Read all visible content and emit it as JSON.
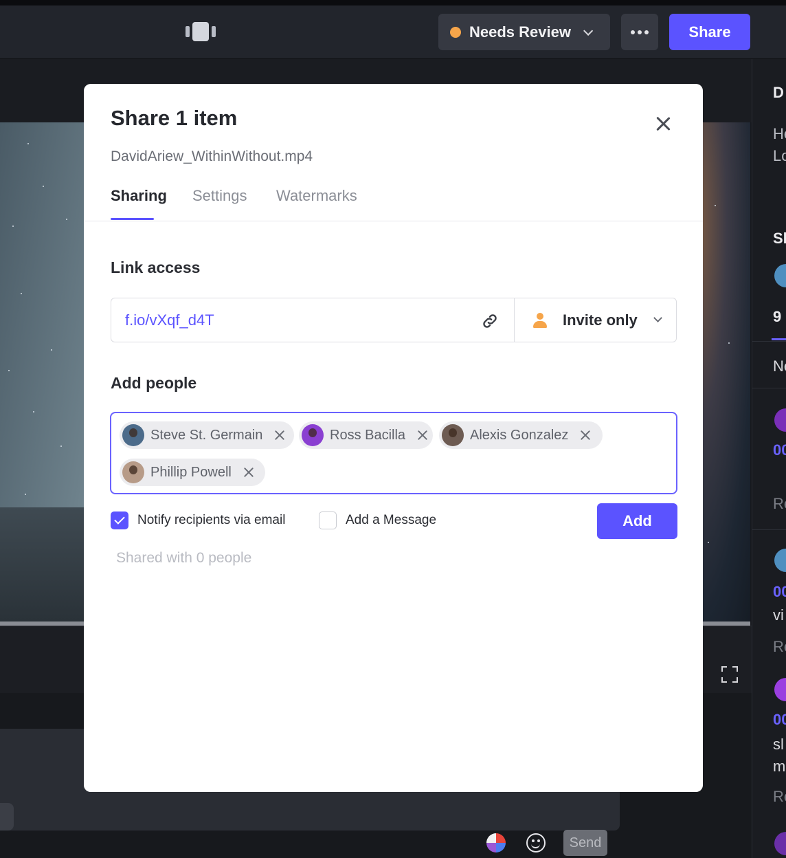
{
  "topbar": {
    "view_mode_icon": "view-mode-icon",
    "status": {
      "label": "Needs Review",
      "color": "#f6a54a"
    },
    "more_icon": "ellipsis-icon",
    "share_label": "Share",
    "accent": "#5b53ff"
  },
  "comment_bar": {
    "send_label": "Send",
    "paint_icon": "paint-brush-icon",
    "emoji_icon": "emoji-icon",
    "fullscreen_icon": "fullscreen-icon"
  },
  "right_panel": {
    "fragments": [
      "D",
      "He",
      "Lo",
      "Sh",
      "9",
      "Ne",
      "00",
      "Re",
      "00",
      "vi",
      "Re",
      "00",
      "sl",
      "m",
      "Re"
    ]
  },
  "modal": {
    "title": "Share 1 item",
    "filename": "DavidAriew_WithinWithout.mp4",
    "close_icon": "close-icon",
    "tabs": [
      {
        "label": "Sharing",
        "active": true
      },
      {
        "label": "Settings",
        "active": false
      },
      {
        "label": "Watermarks",
        "active": false
      }
    ],
    "link_access": {
      "heading": "Link access",
      "url": "f.io/vXqf_d4T",
      "copy_icon": "link-icon",
      "access_icon": "person-icon",
      "access_value": "Invite only"
    },
    "add_people": {
      "heading": "Add people",
      "chips": [
        {
          "name": "Steve St. Germain",
          "avatar_color": "#4c6b8a"
        },
        {
          "name": "Ross Bacilla",
          "avatar_color": "#8a3fd1"
        },
        {
          "name": "Alexis Gonzalez",
          "avatar_color": "#6d5b52"
        },
        {
          "name": "Phillip Powell",
          "avatar_color": "#b79b88"
        }
      ],
      "notify_label": "Notify recipients via email",
      "notify_checked": true,
      "message_label": "Add a Message",
      "message_checked": false,
      "add_label": "Add",
      "shared_with": "Shared with 0 people"
    }
  }
}
